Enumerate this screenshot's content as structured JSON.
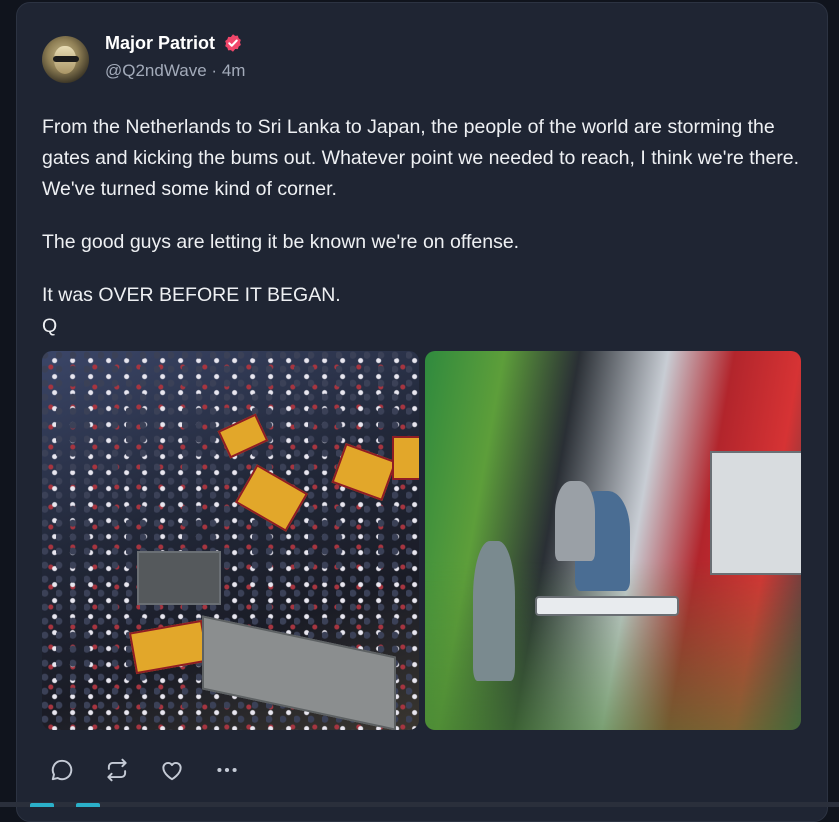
{
  "post": {
    "author": {
      "display_name": "Major Patriot",
      "verified_icon": "verified-badge-icon",
      "handle": "@Q2ndWave",
      "separator": "·",
      "time": "4m"
    },
    "paragraphs": [
      "From the Netherlands to Sri Lanka to Japan, the people of the world are storming the gates and kicking the bums out.  Whatever point we needed to reach, I think we're there.  We've turned some kind of corner.",
      "The good guys are letting it be known we're on offense.",
      "It was OVER BEFORE IT BEGAN.",
      "Q"
    ],
    "media": [
      {
        "icon": "photo-crowd-with-flags"
      },
      {
        "icon": "photo-farmers-on-tractors"
      }
    ],
    "actions": [
      {
        "icon": "reply-icon"
      },
      {
        "icon": "repost-icon"
      },
      {
        "icon": "like-icon"
      },
      {
        "icon": "more-icon"
      }
    ]
  },
  "colors": {
    "background": "#10141d",
    "card": "#1f2533",
    "text": "#eef0f3",
    "muted": "#a3abba",
    "verified": "#f0466a"
  }
}
